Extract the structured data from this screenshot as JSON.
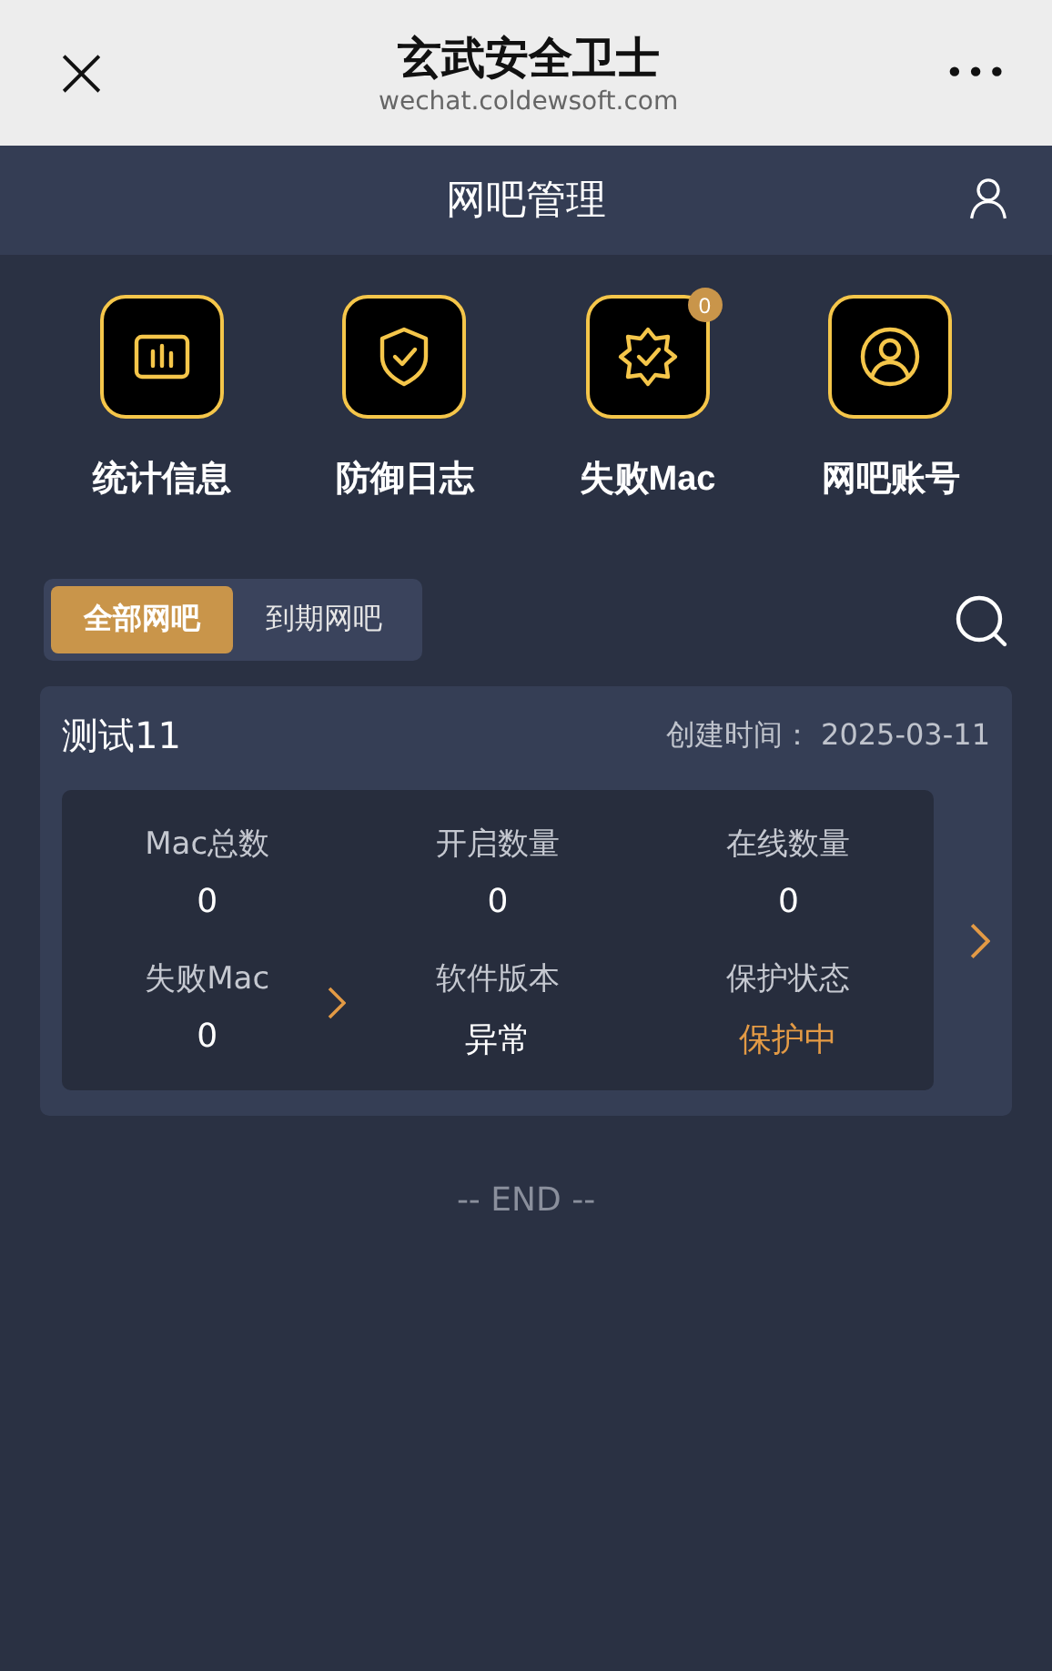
{
  "browser_bar": {
    "close": "×",
    "title": "玄武安全卫士",
    "url": "wechat.coldewsoft.com",
    "more": "•••"
  },
  "nav": {
    "title": "网吧管理"
  },
  "shortcuts": [
    {
      "kind": "chart",
      "label": "统计信息"
    },
    {
      "kind": "shield",
      "label": "防御日志"
    },
    {
      "kind": "badge",
      "label": "失败Mac",
      "count": "0"
    },
    {
      "kind": "user",
      "label": "网吧账号"
    }
  ],
  "tabs": [
    {
      "label": "全部网吧",
      "selected": true
    },
    {
      "label": "到期网吧",
      "selected": false
    }
  ],
  "cards": [
    {
      "name": "测试11",
      "created": "创建时间： 2025-03-11",
      "stats": [
        {
          "kind": "count",
          "label": "Mac总数",
          "value": "0"
        },
        {
          "kind": "count",
          "label": "开启数量",
          "value": "0"
        },
        {
          "kind": "count",
          "label": "在线数量",
          "value": "0"
        },
        {
          "kind": "link",
          "label": "失败Mac",
          "value": "0"
        },
        {
          "kind": "count",
          "label": "软件版本",
          "value": "异常"
        },
        {
          "kind": "status",
          "label": "保护状态",
          "value": "保护中"
        }
      ]
    }
  ],
  "end_text": "-- END --"
}
